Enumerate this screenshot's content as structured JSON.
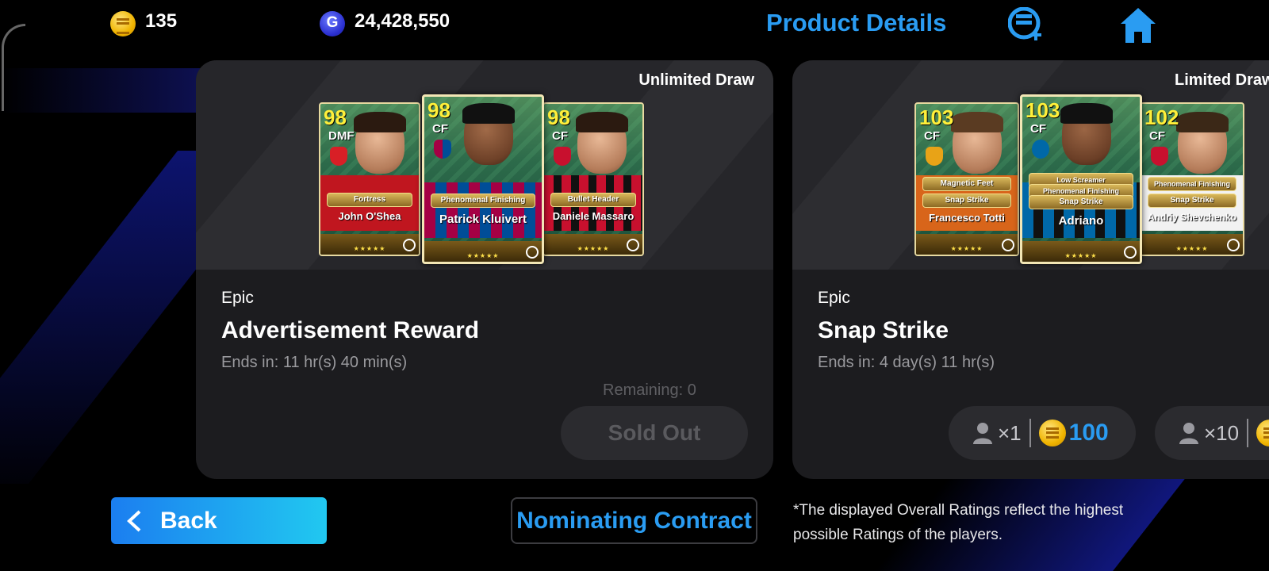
{
  "header": {
    "coins": "135",
    "gp": "24,428,550",
    "gp_icon_letter": "G",
    "title": "Product Details",
    "icons": [
      "ecoin-add-icon",
      "home-icon"
    ]
  },
  "products": [
    {
      "draw_type": "Unlimited Draw",
      "rarity": "Epic",
      "title": "Advertisement Reward",
      "ends": "Ends in: 11 hr(s) 40 min(s)",
      "remaining": "Remaining: 0",
      "button": "Sold Out",
      "players": [
        {
          "rating": "98",
          "pos": "DMF",
          "skills": [
            "Fortress"
          ],
          "name": "John O'Shea",
          "club_color": "#d81f26"
        },
        {
          "rating": "98",
          "pos": "CF",
          "skills": [
            "Phenomenal Finishing"
          ],
          "name": "Patrick Kluivert",
          "club_color": "#a50044"
        },
        {
          "rating": "98",
          "pos": "CF",
          "skills": [
            "Bullet Header"
          ],
          "name": "Daniele Massaro",
          "club_color": "#c8102e"
        }
      ]
    },
    {
      "draw_type": "Limited Draw",
      "rarity": "Epic",
      "title": "Snap Strike",
      "ends": "Ends in: 4 day(s) 11 hr(s)",
      "buy_options": [
        {
          "qty": "×1",
          "price": "100"
        },
        {
          "qty": "×10",
          "price": ""
        }
      ],
      "players": [
        {
          "rating": "103",
          "pos": "CF",
          "skills": [
            "Magnetic Feet",
            "Snap Strike"
          ],
          "name": "Francesco Totti",
          "club_color": "#e8a317"
        },
        {
          "rating": "103",
          "pos": "CF",
          "skills": [
            "Low Screamer",
            "Phenomenal Finishing",
            "Snap Strike"
          ],
          "name": "Adriano",
          "club_color": "#0068a8"
        },
        {
          "rating": "102",
          "pos": "CF",
          "skills": [
            "Phenomenal Finishing",
            "Snap Strike"
          ],
          "name": "Andriy Shevchenko",
          "club_color": "#c8102e"
        }
      ]
    }
  ],
  "footer": {
    "back": "Back",
    "contract": "Nominating Contract",
    "disclaimer": "*The displayed Overall Ratings reflect the highest possible Ratings of the players."
  },
  "colors": {
    "accent_blue": "#2a9cf2",
    "card_bg": "#1c1c1f",
    "rating_yellow": "#ffef3a"
  }
}
